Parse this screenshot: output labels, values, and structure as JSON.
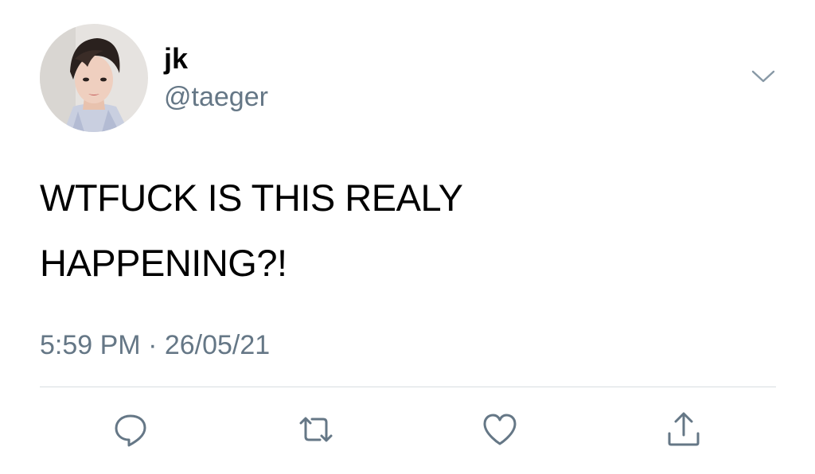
{
  "author": {
    "display_name": "jk",
    "handle": "@taeger",
    "avatar_icon": "profile-photo"
  },
  "tweet": {
    "text_lines": [
      "WTFUCK IS THIS REALY",
      "HAPPENING?!"
    ],
    "timestamp": "5:59 PM · 26/05/21"
  },
  "actions": [
    {
      "name": "reply",
      "icon": "speech-bubble-icon"
    },
    {
      "name": "retweet",
      "icon": "retweet-arrows-icon"
    },
    {
      "name": "like",
      "icon": "heart-icon"
    },
    {
      "name": "share",
      "icon": "share-upload-icon"
    }
  ],
  "colors": {
    "text": "#000000",
    "secondary": "#657786",
    "divider": "#d8dde1",
    "icon": "#657786"
  }
}
